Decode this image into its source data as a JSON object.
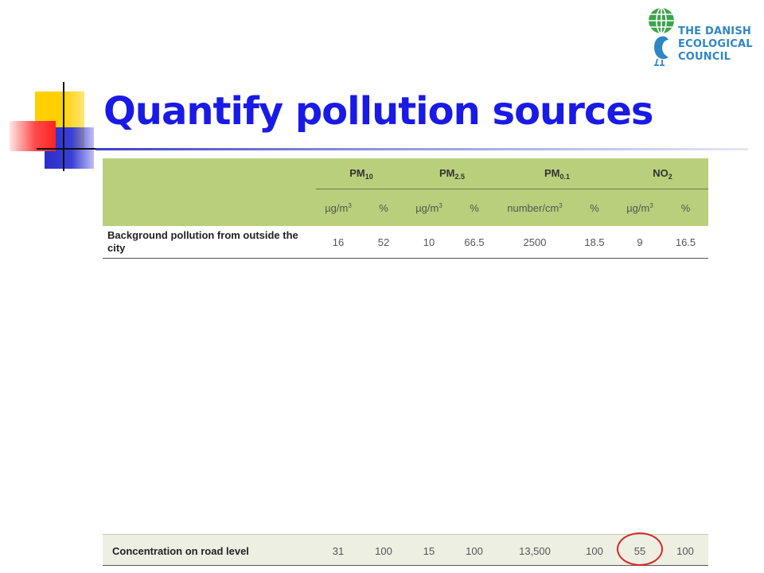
{
  "title": "Quantify pollution sources",
  "logo": {
    "lines": [
      "THE DANISH",
      "ECOLOGICAL",
      "COUNCIL"
    ],
    "icon": "globe-bird-icon",
    "color": "#2f86c5"
  },
  "colors": {
    "title": "#1a1ae6",
    "table_header": "#b9cf7b",
    "footer_row": "#edefe2",
    "highlight_circle": "#d42a2a"
  },
  "table": {
    "groups": [
      {
        "base": "PM",
        "sub": "10"
      },
      {
        "base": "PM",
        "sub": "2.5"
      },
      {
        "base": "PM",
        "sub": "0.1"
      },
      {
        "base": "NO",
        "sub": "2"
      }
    ],
    "units": [
      {
        "base": "µg/m",
        "sup": "3"
      },
      {
        "base": "%",
        "sup": ""
      },
      {
        "base": "µg/m",
        "sup": "3"
      },
      {
        "base": "%",
        "sup": ""
      },
      {
        "base": "number/cm",
        "sup": "3"
      },
      {
        "base": "%",
        "sup": ""
      },
      {
        "base": "µg/m",
        "sup": "3"
      },
      {
        "base": "%",
        "sup": ""
      }
    ],
    "rows": [
      {
        "label": "Background pollution from outside the city",
        "values": [
          "16",
          "52",
          "10",
          "66.5",
          "2500",
          "18.5",
          "9",
          "16.5"
        ]
      }
    ],
    "footer": {
      "label": "Concentration on road level",
      "values": [
        "31",
        "100",
        "15",
        "100",
        "13,500",
        "100",
        "55",
        "100"
      ],
      "highlighted_value": "55"
    }
  }
}
